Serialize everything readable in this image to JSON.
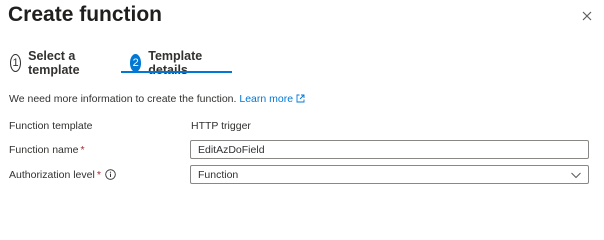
{
  "panel": {
    "title": "Create function",
    "close_icon": "close-icon"
  },
  "steps": [
    {
      "number": "1",
      "label": "Select a template",
      "state": "completed"
    },
    {
      "number": "2",
      "label": "Template details",
      "state": "active"
    }
  ],
  "colors": {
    "accent": "#0078d4",
    "required": "#a4262c",
    "text": "#323130"
  },
  "info": {
    "text": "We need more information to create the function.",
    "link_label": "Learn more",
    "link_icon": "external-link-icon"
  },
  "form": {
    "template": {
      "label": "Function template",
      "value": "HTTP trigger"
    },
    "function_name": {
      "label": "Function name",
      "required_mark": "*",
      "value": "EditAzDoField"
    },
    "authorization_level": {
      "label": "Authorization level",
      "required_mark": "*",
      "info_icon": "info-icon",
      "value": "Function"
    }
  }
}
